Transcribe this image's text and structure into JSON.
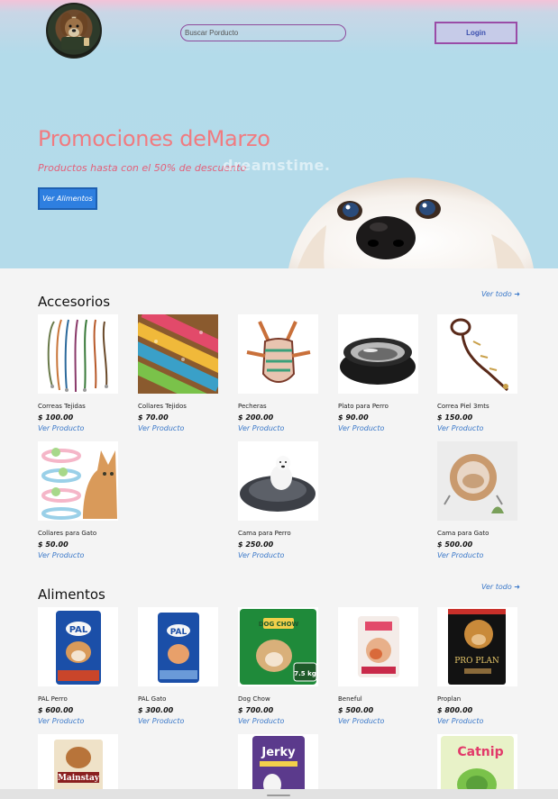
{
  "header": {
    "search_placeholder": "Buscar Porducto",
    "login_label": "Login"
  },
  "hero": {
    "title": "Promociones deMarzo",
    "subtitle": "Productos hasta con el 50% de descuento",
    "watermark": "dreamstime.",
    "button_label": "Ver Alimentos"
  },
  "sections": [
    {
      "title": "Accesorios",
      "see_all": "Ver todo ➜",
      "products": [
        {
          "name": "Correas Tejidas",
          "price": "$ 100.00",
          "link": "Ver Producto",
          "icon": "woven-leashes"
        },
        {
          "name": "Collares Tejidos",
          "price": "$ 70.00",
          "link": "Ver Producto",
          "icon": "woven-collars"
        },
        {
          "name": "Pecheras",
          "price": "$ 200.00",
          "link": "Ver Producto",
          "icon": "harness"
        },
        {
          "name": "Plato para Perro",
          "price": "$ 90.00",
          "link": "Ver Producto",
          "icon": "dog-bowl"
        },
        {
          "name": "Correa Piel 3mts",
          "price": "$ 150.00",
          "link": "Ver Producto",
          "icon": "leather-leash"
        },
        {
          "name": "Collares para Gato",
          "price": "$ 50.00",
          "link": "Ver Producto",
          "icon": "cat-collars"
        },
        {
          "name": "Cama para Perro",
          "price": "$ 250.00",
          "link": "Ver Producto",
          "icon": "dog-bed"
        },
        {
          "name": "Cama para Gato",
          "price": "$ 500.00",
          "link": "Ver Producto",
          "icon": "cat-bed"
        }
      ]
    },
    {
      "title": "Alimentos",
      "see_all": "Ver todo ➜",
      "products": [
        {
          "name": "PAL Perro",
          "price": "$ 600.00",
          "link": "Ver Producto",
          "icon": "pal-dog-food"
        },
        {
          "name": "PAL Gato",
          "price": "$ 300.00",
          "link": "Ver Producto",
          "icon": "pal-cat-food"
        },
        {
          "name": "Dog Chow",
          "price": "$ 700.00",
          "link": "Ver Producto",
          "icon": "dog-chow-bag",
          "badge": "7.5 kg"
        },
        {
          "name": "Beneful",
          "price": "$ 500.00",
          "link": "Ver Producto",
          "icon": "beneful-bag"
        },
        {
          "name": "Proplan",
          "price": "$ 800.00",
          "link": "Ver Producto",
          "icon": "proplan-pouch"
        },
        {
          "name": "",
          "price": "",
          "link": "",
          "icon": "mainstay-bag",
          "label_text": "Mainstay"
        },
        {
          "name": "",
          "price": "",
          "link": "",
          "icon": "jerky-bag",
          "label_text": "Jerky"
        },
        {
          "name": "",
          "price": "",
          "link": "",
          "icon": "catnip-bag",
          "label_text": "Catnip"
        }
      ]
    }
  ]
}
